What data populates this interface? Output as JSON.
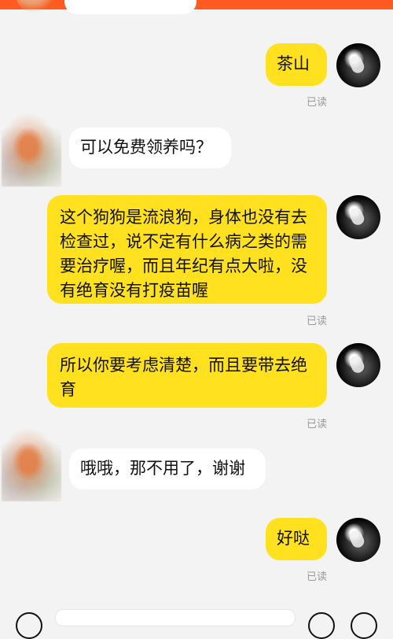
{
  "chat": {
    "messages": [
      {
        "side": "right",
        "text": "茶山",
        "read": "已读"
      },
      {
        "side": "left",
        "text": "可以免费领养吗？"
      },
      {
        "side": "right",
        "text": "这个狗狗是流浪狗，身体也没有去检查过，说不定有什么病之类的需要治疗喔，而且年纪有点大啦，没有绝育没有打疫苗喔",
        "read": "已读"
      },
      {
        "side": "right",
        "text": "所以你要考虑清楚，而且要带去绝育",
        "read": "已读"
      },
      {
        "side": "left",
        "text": "哦哦，那不用了，谢谢"
      },
      {
        "side": "right",
        "text": "好哒",
        "read": "已读"
      }
    ]
  },
  "colors": {
    "accent_topbar": "#ff5a1f",
    "bubble_right": "#ffe11f",
    "bubble_left": "#ffffff",
    "background": "#f3f3f3",
    "read_text": "#9a9a9a"
  },
  "icons": {
    "left_avatar": "blurred-orange-avatar",
    "right_avatar": "portrait-avatar"
  }
}
